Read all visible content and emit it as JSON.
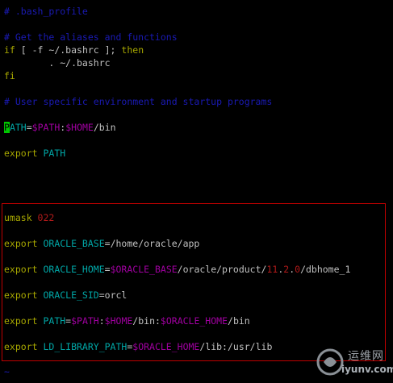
{
  "editor": {
    "line1": "# .bash_profile",
    "line3": "# Get the aliases and functions",
    "line4": {
      "kw_if": "if",
      "test": " [ -f ~/.bashrc ]; ",
      "kw_then": "then"
    },
    "line5": "        . ~/.bashrc",
    "line6": "fi",
    "line8": "# User specific environment and startup programs",
    "line10": {
      "cursor": "P",
      "name": "ATH",
      "eq": "=",
      "var1": "$PATH",
      "colon": ":",
      "var2": "$HOME",
      "rest": "/bin"
    },
    "line12": {
      "kw": "export",
      "name": " PATH"
    },
    "line16": {
      "kw": "umask",
      "value": " 022"
    },
    "line18": {
      "kw": "export",
      "name": " ORACLE_BASE",
      "eq": "=",
      "rest": "/home/oracle/app"
    },
    "line20": {
      "kw": "export",
      "name": " ORACLE_HOME",
      "eq": "=",
      "var": "$ORACLE_BASE",
      "p1": "/oracle/product/",
      "n1": "11",
      "dot1": ".",
      "n2": "2",
      "dot2": ".",
      "n3": "0",
      "p2": "/dbhome_1"
    },
    "line22": {
      "kw": "export",
      "name": " ORACLE_SID",
      "eq": "=",
      "rest": "orcl"
    },
    "line24": {
      "kw": "export",
      "name": " PATH",
      "eq": "=",
      "var1": "$PATH",
      "c1": ":",
      "var2": "$HOME",
      "p1": "/bin:",
      "var3": "$ORACLE_HOME",
      "p2": "/bin"
    },
    "line26": {
      "kw": "export",
      "name": " LD_LIBRARY_PATH",
      "eq": "=",
      "var": "$ORACLE_HOME",
      "rest": "/lib:/usr/lib"
    },
    "tilde": "~"
  },
  "watermark": {
    "title": "运维网",
    "url": "iyunv.com",
    "icon": "yunv-logo-icon"
  },
  "colors": {
    "comment": "#1a1ab4",
    "keyword": "#a7a700",
    "identifier": "#00a6a6",
    "variable": "#a000a0",
    "number": "#b21a1a",
    "cursor": "#00c800",
    "highlight_box": "#c00000"
  }
}
